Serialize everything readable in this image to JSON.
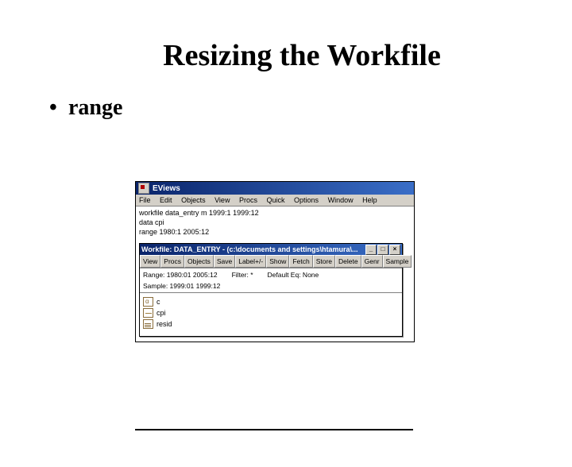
{
  "slide": {
    "title": "Resizing the Workfile",
    "bullet": "range"
  },
  "app": {
    "title": "EViews",
    "menu": {
      "file": "File",
      "edit": "Edit",
      "objects": "Objects",
      "view": "View",
      "procs": "Procs",
      "quick": "Quick",
      "options": "Options",
      "window": "Window",
      "help": "Help"
    },
    "cmd1": "workfile data_entry m 1999:1 1999:12",
    "cmd2": "data cpi",
    "cmd3": "range 1980:1 2005:12"
  },
  "child": {
    "title": "Workfile: DATA_ENTRY - (c:\\documents and settings\\htamura\\...",
    "toolbar": {
      "view": "View",
      "procs": "Procs",
      "objects": "Objects",
      "save": "Save",
      "label": "Label+/-",
      "show": "Show",
      "fetch": "Fetch",
      "store": "Store",
      "delete": "Delete",
      "genr": "Genr",
      "sample": "Sample"
    },
    "range_label": "Range: 1980:01 2005:12",
    "filter_label": "Filter: *",
    "default_label": "Default Eq: None",
    "sample_label": "Sample: 1999:01 1999:12",
    "objs": {
      "c": "c",
      "cpi": "cpi",
      "resid": "resid"
    }
  }
}
